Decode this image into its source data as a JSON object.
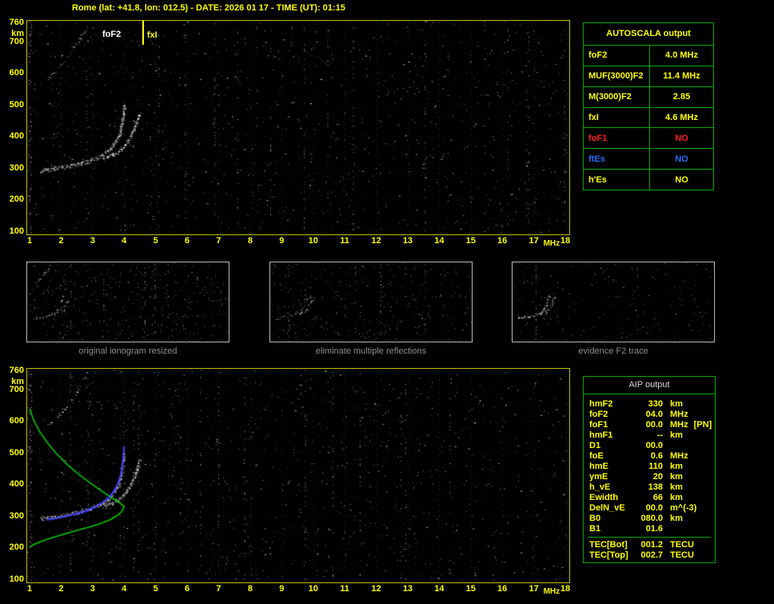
{
  "header": {
    "title": "Rome (lat: +41.8, lon: 012.5) - DATE: 2026 01 17 - TIME (UT): 01:15"
  },
  "colors": {
    "accent_yellow": "#ffff00",
    "plot_border_yellow": "#bfbf00",
    "table_border_green": "#00a800",
    "status_red": "#ff1f1f",
    "status_blue": "#1f6fff",
    "caption_gray": "#8f8f8f",
    "profile_green": "#00cc00",
    "fitted_blue": "#4343ff"
  },
  "autoscala_table": {
    "title": "AUTOSCALA output",
    "rows": [
      {
        "label": "foF2",
        "value": "4.0 MHz",
        "color": "yellow"
      },
      {
        "label": "MUF(3000)F2",
        "value": "11.4 MHz",
        "color": "yellow"
      },
      {
        "label": "M(3000)F2",
        "value": "2.85",
        "color": "yellow"
      },
      {
        "label": "fxI",
        "value": "4.6 MHz",
        "color": "yellow"
      },
      {
        "label": "foF1",
        "value": "NO",
        "color": "red"
      },
      {
        "label": "ftEs",
        "value": "NO",
        "color": "blue"
      },
      {
        "label": "h'Es",
        "value": "NO",
        "color": "yellow"
      }
    ]
  },
  "aip_table": {
    "title": "AIP output",
    "rows": [
      {
        "label": "hmF2",
        "value": "330",
        "unit": "km",
        "extra": ""
      },
      {
        "label": "foF2",
        "value": "04.0",
        "unit": "MHz",
        "extra": ""
      },
      {
        "label": "foF1",
        "value": "00.0",
        "unit": "MHz",
        "extra": "[PN]"
      },
      {
        "label": "hmF1",
        "value": "--",
        "unit": "km",
        "extra": ""
      },
      {
        "label": "D1",
        "value": "00.0",
        "unit": "",
        "extra": ""
      },
      {
        "label": "foE",
        "value": "0.6",
        "unit": "MHz",
        "extra": ""
      },
      {
        "label": "hmE",
        "value": "110",
        "unit": "km",
        "extra": ""
      },
      {
        "label": "ymE",
        "value": "20",
        "unit": "km",
        "extra": ""
      },
      {
        "label": "h_vE",
        "value": "138",
        "unit": "km",
        "extra": ""
      },
      {
        "label": "Ewidth",
        "value": "66",
        "unit": "km",
        "extra": ""
      },
      {
        "label": "DelN_vE",
        "value": "00.0",
        "unit": "m^(-3)",
        "extra": ""
      },
      {
        "label": "B0",
        "value": "080.0",
        "unit": "km",
        "extra": ""
      },
      {
        "label": "B1",
        "value": "01.6",
        "unit": "",
        "extra": ""
      }
    ],
    "tec_rows": [
      {
        "label": "TEC[Bot]",
        "value": "001.2",
        "unit": "TECU",
        "extra": ""
      },
      {
        "label": "TEC[Top]",
        "value": "002.7",
        "unit": "TECU",
        "extra": ""
      }
    ]
  },
  "thumbnails": [
    {
      "caption": "original ionogram resized"
    },
    {
      "caption": "eliminate multiple reflections"
    },
    {
      "caption": "evidence F2 trace"
    }
  ],
  "chart_data": [
    {
      "type": "scatter",
      "title": "",
      "xlabel": "MHz",
      "ylabel": "km",
      "xlim": [
        1,
        18
      ],
      "ylim": [
        100,
        760
      ],
      "grid": true,
      "x_ticks": [
        1,
        2,
        3,
        4,
        5,
        6,
        7,
        8,
        9,
        10,
        11,
        12,
        13,
        14,
        15,
        16,
        17,
        18
      ],
      "y_ticks": [
        760,
        700,
        600,
        500,
        400,
        300,
        200,
        100
      ],
      "annotations": [
        {
          "text": "foF2",
          "f": 4.0,
          "color": "#ffffff",
          "side": "left",
          "marker": false
        },
        {
          "text": "fxI",
          "f": 4.6,
          "color": "#ffff00",
          "side": "right",
          "marker": true
        }
      ],
      "series": [
        {
          "name": "F2 ordinary trace",
          "render": "dots",
          "color": "#ffffff",
          "points": [
            [
              1.35,
              292
            ],
            [
              1.6,
              295
            ],
            [
              1.85,
              299
            ],
            [
              2.1,
              303
            ],
            [
              2.35,
              308
            ],
            [
              2.6,
              314
            ],
            [
              2.85,
              321
            ],
            [
              3.1,
              330
            ],
            [
              3.3,
              341
            ],
            [
              3.5,
              355
            ],
            [
              3.65,
              371
            ],
            [
              3.78,
              391
            ],
            [
              3.87,
              415
            ],
            [
              3.93,
              443
            ],
            [
              3.97,
              475
            ],
            [
              3.99,
              505
            ]
          ]
        },
        {
          "name": "F2 extraordinary trace",
          "render": "dots",
          "color": "#ffffff",
          "points": [
            [
              3.35,
              330
            ],
            [
              3.6,
              340
            ],
            [
              3.8,
              352
            ],
            [
              3.98,
              367
            ],
            [
              4.12,
              385
            ],
            [
              4.25,
              408
            ],
            [
              4.35,
              432
            ],
            [
              4.44,
              458
            ],
            [
              4.5,
              478
            ]
          ]
        },
        {
          "name": "second hop trace",
          "render": "dots",
          "color": "#ffffff",
          "sparse": true,
          "points": [
            [
              1.6,
              585
            ],
            [
              1.75,
              602
            ],
            [
              1.9,
              618
            ],
            [
              2.05,
              634
            ],
            [
              2.2,
              652
            ],
            [
              2.35,
              672
            ],
            [
              2.5,
              694
            ],
            [
              2.65,
              718
            ],
            [
              2.78,
              740
            ],
            [
              2.88,
              756
            ]
          ]
        }
      ]
    },
    {
      "type": "scatter",
      "title": "",
      "xlabel": "MHz",
      "ylabel": "km",
      "xlim": [
        1,
        18
      ],
      "ylim": [
        100,
        760
      ],
      "grid": true,
      "x_ticks": [
        1,
        2,
        3,
        4,
        5,
        6,
        7,
        8,
        9,
        10,
        11,
        12,
        13,
        14,
        15,
        16,
        17,
        18
      ],
      "y_ticks": [
        760,
        700,
        600,
        500,
        400,
        300,
        200,
        100
      ],
      "annotations": [],
      "series": [
        {
          "name": "F2 ordinary trace",
          "render": "dots",
          "color": "#ffffff",
          "points": [
            [
              1.35,
              292
            ],
            [
              1.6,
              295
            ],
            [
              1.85,
              299
            ],
            [
              2.1,
              303
            ],
            [
              2.35,
              308
            ],
            [
              2.6,
              314
            ],
            [
              2.85,
              321
            ],
            [
              3.1,
              330
            ],
            [
              3.3,
              341
            ],
            [
              3.5,
              355
            ],
            [
              3.65,
              371
            ],
            [
              3.78,
              391
            ],
            [
              3.87,
              415
            ],
            [
              3.93,
              443
            ],
            [
              3.97,
              475
            ],
            [
              3.99,
              505
            ]
          ]
        },
        {
          "name": "F2 extraordinary trace",
          "render": "dots",
          "color": "#ffffff",
          "points": [
            [
              3.35,
              330
            ],
            [
              3.6,
              340
            ],
            [
              3.8,
              352
            ],
            [
              3.98,
              367
            ],
            [
              4.12,
              385
            ],
            [
              4.25,
              408
            ],
            [
              4.35,
              432
            ],
            [
              4.44,
              458
            ],
            [
              4.5,
              478
            ]
          ]
        },
        {
          "name": "second hop trace",
          "render": "dots",
          "color": "#ffffff",
          "sparse": true,
          "points": [
            [
              1.6,
              585
            ],
            [
              1.75,
              602
            ],
            [
              1.9,
              618
            ],
            [
              2.05,
              634
            ],
            [
              2.2,
              652
            ],
            [
              2.35,
              672
            ],
            [
              2.5,
              694
            ],
            [
              2.65,
              718
            ],
            [
              2.78,
              740
            ],
            [
              2.88,
              756
            ]
          ]
        },
        {
          "name": "electron density profile",
          "render": "line",
          "color": "#00cc00",
          "points": [
            [
              1.0,
              638
            ],
            [
              1.12,
              605
            ],
            [
              1.3,
              570
            ],
            [
              1.55,
              533
            ],
            [
              1.85,
              497
            ],
            [
              2.2,
              462
            ],
            [
              2.58,
              430
            ],
            [
              2.95,
              402
            ],
            [
              3.3,
              378
            ],
            [
              3.6,
              358
            ],
            [
              3.85,
              342
            ],
            [
              4.0,
              330
            ],
            [
              3.93,
              315
            ],
            [
              3.78,
              301
            ],
            [
              3.55,
              288
            ],
            [
              3.25,
              276
            ],
            [
              2.9,
              265
            ],
            [
              2.5,
              254
            ],
            [
              2.1,
              243
            ],
            [
              1.7,
              231
            ],
            [
              1.35,
              219
            ],
            [
              1.1,
              208
            ],
            [
              1.0,
              201
            ]
          ]
        },
        {
          "name": "autoscala fitted trace",
          "render": "line-dots",
          "color": "#4343ff",
          "points": [
            [
              1.55,
              288
            ],
            [
              1.85,
              293
            ],
            [
              2.15,
              299
            ],
            [
              2.45,
              306
            ],
            [
              2.75,
              315
            ],
            [
              3.05,
              327
            ],
            [
              3.3,
              341
            ],
            [
              3.5,
              357
            ],
            [
              3.67,
              377
            ],
            [
              3.8,
              401
            ],
            [
              3.89,
              429
            ],
            [
              3.95,
              462
            ],
            [
              3.98,
              495
            ],
            [
              4.0,
              520
            ]
          ]
        }
      ]
    }
  ]
}
